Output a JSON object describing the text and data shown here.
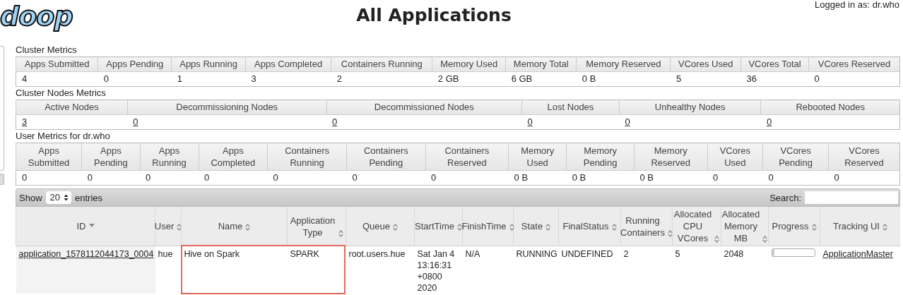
{
  "header": {
    "logo": "doop",
    "title": "All Applications",
    "login": "Logged in as: dr.who"
  },
  "cluster_metrics": {
    "title": "Cluster Metrics",
    "columns": [
      "Apps Submitted",
      "Apps Pending",
      "Apps Running",
      "Apps Completed",
      "Containers Running",
      "Memory Used",
      "Memory Total",
      "Memory Reserved",
      "VCores Used",
      "VCores Total",
      "VCores Reserved"
    ],
    "values": [
      {
        "text": "4",
        "link": false
      },
      {
        "text": "0",
        "link": false
      },
      {
        "text": "1",
        "link": false
      },
      {
        "text": "3",
        "link": false
      },
      {
        "text": "2",
        "link": false
      },
      {
        "text": "2 GB",
        "link": false
      },
      {
        "text": "6 GB",
        "link": false
      },
      {
        "text": "0 B",
        "link": false
      },
      {
        "text": "5",
        "link": false
      },
      {
        "text": "36",
        "link": false
      },
      {
        "text": "0",
        "link": false
      }
    ]
  },
  "cluster_nodes_metrics": {
    "title": "Cluster Nodes Metrics",
    "columns": [
      "Active Nodes",
      "Decommissioning Nodes",
      "Decommissioned Nodes",
      "Lost Nodes",
      "Unhealthy Nodes",
      "Rebooted Nodes"
    ],
    "values": [
      {
        "text": "3",
        "link": true
      },
      {
        "text": "0",
        "link": true
      },
      {
        "text": "0",
        "link": true
      },
      {
        "text": "0",
        "link": true
      },
      {
        "text": "0",
        "link": true
      },
      {
        "text": "0",
        "link": true
      }
    ]
  },
  "user_metrics": {
    "title": "User Metrics for dr.who",
    "columns": [
      "Apps Submitted",
      "Apps Pending",
      "Apps Running",
      "Apps Completed",
      "Containers Running",
      "Containers Pending",
      "Containers Reserved",
      "Memory Used",
      "Memory Pending",
      "Memory Reserved",
      "VCores Used",
      "VCores Pending",
      "VCores Reserved"
    ],
    "values": [
      {
        "text": "0",
        "link": false
      },
      {
        "text": "0",
        "link": false
      },
      {
        "text": "0",
        "link": false
      },
      {
        "text": "0",
        "link": false
      },
      {
        "text": "0",
        "link": false
      },
      {
        "text": "0",
        "link": false
      },
      {
        "text": "0",
        "link": false
      },
      {
        "text": "0 B",
        "link": false
      },
      {
        "text": "0 B",
        "link": false
      },
      {
        "text": "0 B",
        "link": false
      },
      {
        "text": "0",
        "link": false
      },
      {
        "text": "0",
        "link": false
      },
      {
        "text": "0",
        "link": false
      }
    ]
  },
  "table_controls": {
    "show_label": "Show",
    "page_size": "20",
    "entries_label": "entries",
    "search_label": "Search:"
  },
  "applications": {
    "columns": [
      {
        "label": "ID",
        "sorted": true,
        "boxed": false
      },
      {
        "label": "User",
        "sorted": false,
        "boxed": false
      },
      {
        "label": "Name",
        "sorted": false,
        "boxed": true
      },
      {
        "label": "Application Type",
        "sorted": false,
        "boxed": true
      },
      {
        "label": "Queue",
        "sorted": false,
        "boxed": false
      },
      {
        "label": "StartTime",
        "sorted": false,
        "boxed": false
      },
      {
        "label": "FinishTime",
        "sorted": false,
        "boxed": false
      },
      {
        "label": "State",
        "sorted": false,
        "boxed": false
      },
      {
        "label": "FinalStatus",
        "sorted": false,
        "boxed": false
      },
      {
        "label": "Running Containers",
        "sorted": false,
        "boxed": false
      },
      {
        "label": "Allocated CPU VCores",
        "sorted": false,
        "boxed": false
      },
      {
        "label": "Allocated Memory MB",
        "sorted": false,
        "boxed": false
      },
      {
        "label": "Progress",
        "sorted": false,
        "boxed": false
      },
      {
        "label": "Tracking UI",
        "sorted": false,
        "boxed": false
      }
    ],
    "rows": [
      {
        "cells": [
          {
            "kind": "link",
            "text": "application_1578112044173_0004"
          },
          {
            "kind": "text",
            "text": "hue"
          },
          {
            "kind": "text",
            "text": "Hive on Spark"
          },
          {
            "kind": "text",
            "text": "SPARK"
          },
          {
            "kind": "text",
            "text": "root.users.hue"
          },
          {
            "kind": "text",
            "text": "Sat Jan 4 13:16:31 +0800 2020"
          },
          {
            "kind": "text",
            "text": "N/A"
          },
          {
            "kind": "text",
            "text": "RUNNING"
          },
          {
            "kind": "text",
            "text": "UNDEFINED"
          },
          {
            "kind": "text",
            "text": "2"
          },
          {
            "kind": "text",
            "text": "5"
          },
          {
            "kind": "text",
            "text": "2048"
          },
          {
            "kind": "progress",
            "level": 0.05
          },
          {
            "kind": "link",
            "text": "ApplicationMaster"
          }
        ]
      }
    ]
  }
}
